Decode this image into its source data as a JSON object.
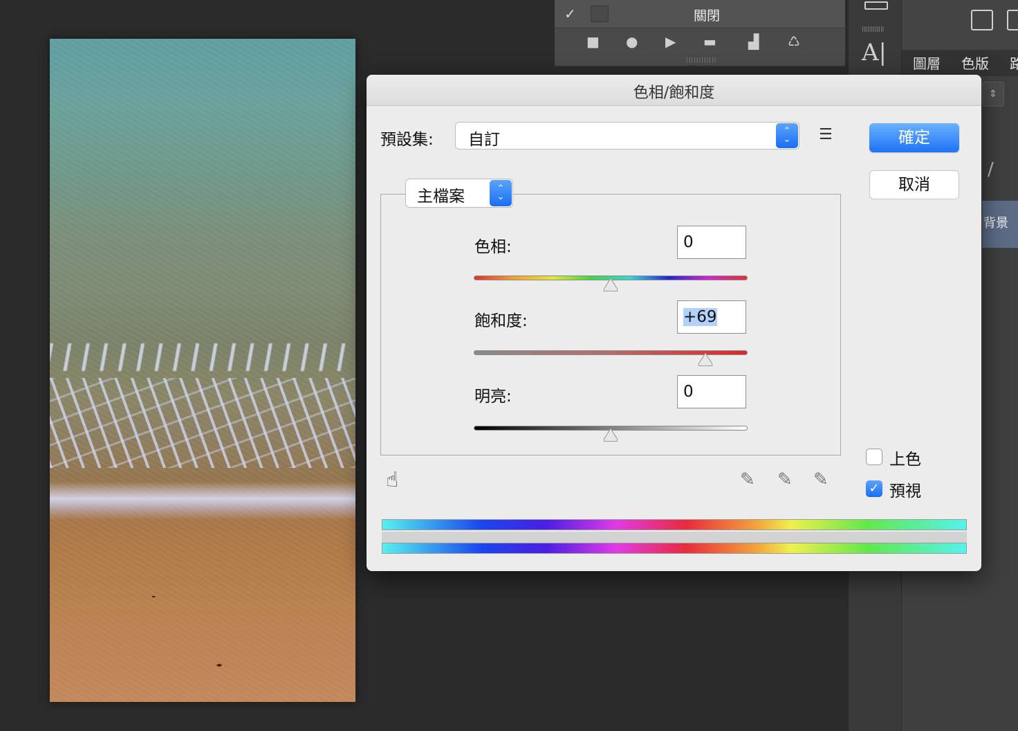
{
  "actions_panel": {
    "check": "✓",
    "close_label": "關閉",
    "controls": [
      "stop-icon",
      "record-icon",
      "play-icon",
      "folder-icon",
      "new-action-icon",
      "trash-icon"
    ]
  },
  "tools": {
    "text_tool": "A|"
  },
  "layers_panel": {
    "tabs": [
      "圖層",
      "色版",
      "路"
    ],
    "layer_name": "背景"
  },
  "dialog": {
    "title": "色相/飽和度",
    "preset_label": "預設集:",
    "preset_value": "自訂",
    "ok_label": "確定",
    "cancel_label": "取消",
    "channel_value": "主檔案",
    "hue": {
      "label": "色相:",
      "value": "0",
      "level": 0.5
    },
    "saturation": {
      "label": "飽和度:",
      "value": "+69",
      "level": 0.845
    },
    "lightness": {
      "label": "明亮:",
      "value": "0",
      "level": 0.5
    },
    "colorize_label": "上色",
    "colorize_checked": false,
    "preview_label": "預視",
    "preview_checked": true
  },
  "colors": {
    "accent": "#1d74f5",
    "app_background": "#2b2b2b",
    "dialog_background": "#ececec"
  }
}
